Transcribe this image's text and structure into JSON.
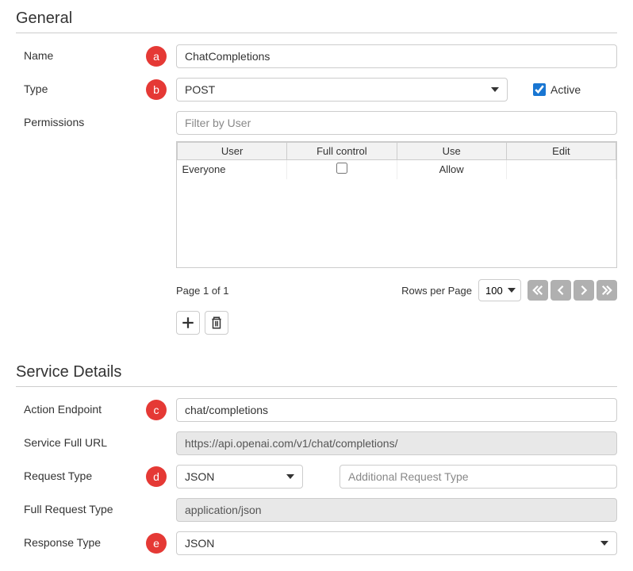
{
  "general": {
    "header": "General",
    "name": {
      "label": "Name",
      "value": "ChatCompletions",
      "badge": "a"
    },
    "type": {
      "label": "Type",
      "value": "POST",
      "badge": "b",
      "activeLabel": "Active",
      "activeChecked": true
    },
    "permissions": {
      "label": "Permissions",
      "filterPlaceholder": "Filter by User",
      "columns": {
        "user": "User",
        "full_control": "Full control",
        "use": "Use",
        "edit": "Edit"
      },
      "rows": [
        {
          "user": "Everyone",
          "full_control": false,
          "use": "Allow",
          "edit": ""
        }
      ],
      "pager": {
        "pageInfo": "Page 1 of 1",
        "rowsPerPageLabel": "Rows per Page",
        "rowsPerPage": "100"
      }
    }
  },
  "service": {
    "header": "Service Details",
    "endpoint": {
      "label": "Action Endpoint",
      "value": "chat/completions",
      "badge": "c"
    },
    "fullUrl": {
      "label": "Service Full URL",
      "value": "https://api.openai.com/v1/chat/completions/"
    },
    "requestType": {
      "label": "Request Type",
      "value": "JSON",
      "badge": "d",
      "additionalPlaceholder": "Additional Request Type"
    },
    "fullRequestType": {
      "label": "Full Request Type",
      "value": "application/json"
    },
    "responseType": {
      "label": "Response Type",
      "value": "JSON",
      "badge": "e"
    }
  }
}
